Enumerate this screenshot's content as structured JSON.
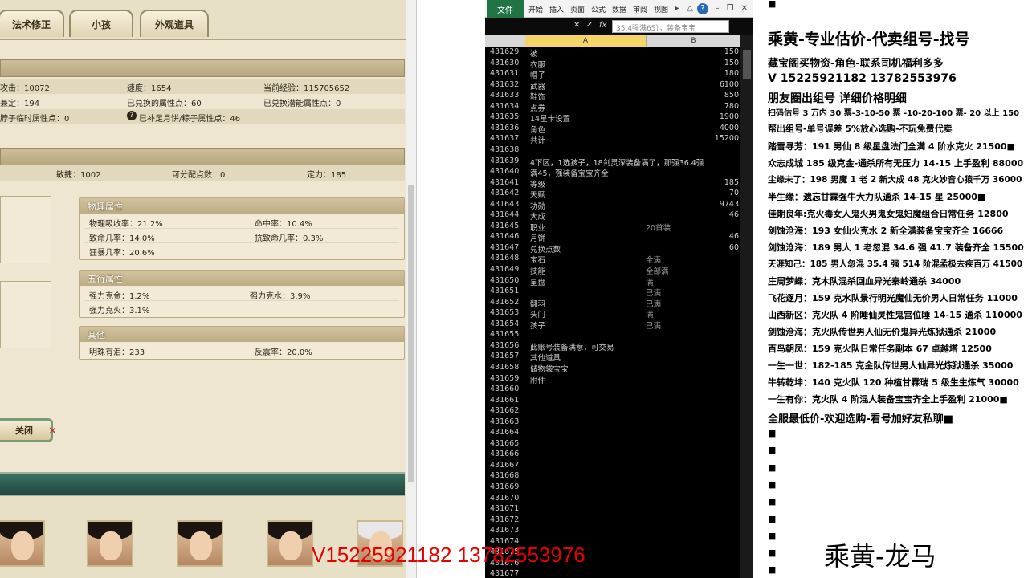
{
  "game": {
    "tabs": [
      "法术修正",
      "小孩",
      "外观道具"
    ],
    "stats_rows": [
      {
        "c1": "攻击：10072",
        "c2": "速度：1654",
        "c3": "当前经验：115705652"
      },
      {
        "c1": "兼定：194",
        "c2": "已兑换的属性点：60",
        "c3": "已兑换潜能属性点：0"
      },
      {
        "c1": "脖子临时属性点：0",
        "c2": "已补足月饼/粽子属性点：46",
        "c3": ""
      }
    ],
    "attr_row": {
      "c1": "敏捷：1002",
      "c2": "可分配点数：0",
      "c3": "定力：185"
    },
    "physical": {
      "title": "物理属性",
      "lines": [
        {
          "a": "物理吸收率：21.2%",
          "b": "命中率：10.4%"
        },
        {
          "a": "致命几率：14.0%",
          "b": "抗致命几率：0.3%"
        },
        {
          "a": "狂暴几率：20.6%",
          "b": ""
        }
      ]
    },
    "elements": {
      "title": "五行属性",
      "lines": [
        {
          "a": "强力克金：1.2%",
          "b": "强力克水：3.9%"
        },
        {
          "a": "强力克火：3.1%",
          "b": ""
        }
      ]
    },
    "other": {
      "title": "其他",
      "lines": [
        {
          "a": "明珠有泪：233",
          "b": "反震率：20.0%"
        }
      ]
    },
    "close_label": "关闭"
  },
  "excel": {
    "file_tab": "文件",
    "ribbon_tabs": [
      "开始",
      "插入",
      "页面",
      "公式",
      "数据",
      "审阅",
      "视图"
    ],
    "formula_text": "35.4强满65），装备宝宝",
    "col_a": "A",
    "col_b": "B",
    "rows": [
      {
        "n": "431629",
        "a": "被",
        "b": "150"
      },
      {
        "n": "431630",
        "a": "衣服",
        "b": "150"
      },
      {
        "n": "431631",
        "a": "帽子",
        "b": "180"
      },
      {
        "n": "431632",
        "a": "武器",
        "b": "6100"
      },
      {
        "n": "431633",
        "a": "鞋饰",
        "b": "850"
      },
      {
        "n": "431634",
        "a": "点券",
        "b": "780"
      },
      {
        "n": "431635",
        "a": "14星卡设置",
        "b": "1900"
      },
      {
        "n": "431636",
        "a": "角色",
        "b": "4000"
      },
      {
        "n": "431637",
        "a": "共计",
        "b": "15200"
      },
      {
        "n": "431638",
        "a": "",
        "b": ""
      },
      {
        "n": "431639",
        "a": "4下区，1选孩子，18剑灵深装备满了，那强36.4强",
        "b": ""
      },
      {
        "n": "431640",
        "a": "满45，强装备宝宝齐全",
        "b": ""
      },
      {
        "n": "431641",
        "a": "等级",
        "b": "185"
      },
      {
        "n": "431642",
        "a": "天赋",
        "b": "70"
      },
      {
        "n": "431643",
        "a": "功勋",
        "b": "9743"
      },
      {
        "n": "431644",
        "a": "大成",
        "b": "46"
      },
      {
        "n": "431645",
        "a": "职业",
        "m": "20首装"
      },
      {
        "n": "431646",
        "a": "月饼",
        "b": "46"
      },
      {
        "n": "431647",
        "a": "兑换点数",
        "b": "60"
      },
      {
        "n": "431648",
        "a": "宝石",
        "m": "全满"
      },
      {
        "n": "431649",
        "a": "技能",
        "m": "全部满"
      },
      {
        "n": "431650",
        "a": "星盘",
        "m": "满"
      },
      {
        "n": "431651",
        "a": "",
        "m": "已满"
      },
      {
        "n": "431652",
        "a": "翻羽",
        "m": "已满"
      },
      {
        "n": "431653",
        "a": "头门",
        "m": "满"
      },
      {
        "n": "431654",
        "a": "孩子",
        "m": "已满"
      },
      {
        "n": "431655",
        "a": "",
        "b": ""
      },
      {
        "n": "431656",
        "a": "此账号装备满意，可交易",
        "b": ""
      },
      {
        "n": "431657",
        "a": "其他道具",
        "b": ""
      },
      {
        "n": "431658",
        "a": "储物袋宝宝",
        "b": ""
      },
      {
        "n": "431659",
        "a": "附件",
        "b": ""
      },
      {
        "n": "431660",
        "a": "",
        "b": ""
      },
      {
        "n": "431661",
        "a": "",
        "b": ""
      },
      {
        "n": "431662",
        "a": "",
        "b": ""
      },
      {
        "n": "431663",
        "a": "",
        "b": ""
      },
      {
        "n": "431664",
        "a": "",
        "b": ""
      },
      {
        "n": "431665",
        "a": "",
        "b": ""
      },
      {
        "n": "431666",
        "a": "",
        "b": ""
      },
      {
        "n": "431667",
        "a": "",
        "b": ""
      },
      {
        "n": "431668",
        "a": "",
        "b": ""
      },
      {
        "n": "431669",
        "a": "",
        "b": ""
      },
      {
        "n": "431670",
        "a": "",
        "b": ""
      },
      {
        "n": "431671",
        "a": "",
        "b": ""
      },
      {
        "n": "431672",
        "a": "",
        "b": ""
      },
      {
        "n": "431673",
        "a": "",
        "b": ""
      },
      {
        "n": "431674",
        "a": "",
        "b": ""
      },
      {
        "n": "431675",
        "a": "",
        "b": ""
      },
      {
        "n": "431676",
        "a": "",
        "b": ""
      },
      {
        "n": "431677",
        "a": "",
        "b": ""
      }
    ]
  },
  "note": {
    "title": "乘黄-专业估价-代卖组号-找号",
    "lines": [
      {
        "t": "藏宝阁买物资-角色-联系司机福利多多",
        "cls": "mid"
      },
      {
        "t": "V 15225921182   13782553976",
        "cls": "big"
      },
      {
        "t": "朋友圈出组号   详细价格明细",
        "cls": "big"
      },
      {
        "t": "扫码估号 3 万内 30 票-3-10-50 票  -10-20-100 票- 20 以上 150",
        "cls": ""
      },
      {
        "t": "帮出组号-单号误差 5%放心选购-不玩免费代卖",
        "cls": ""
      },
      {
        "t": "踏雪寻芳：191 男仙 8 级星盘法门全满 4 阶水克火 21500■",
        "cls": ""
      },
      {
        "t": "众志成城  185 级克金-通杀所有无压力 14-15 上手盈利 88000",
        "cls": ""
      },
      {
        "t": "尘缘未了：198 男魔 1 老 2 新大成 48 克火妙音心猿千万 36000",
        "cls": ""
      },
      {
        "t": "半生缘：遗忘甘霖强牛大力队通杀 14-15 星 25000■",
        "cls": ""
      },
      {
        "t": "佳期良年:克火毒女人鬼火男鬼女鬼妇魔组合日常任务 12800",
        "cls": ""
      },
      {
        "t": "剑蚀沧海：193 女仙火克水 2 新全满装备宝宝齐全 16666",
        "cls": ""
      },
      {
        "t": "剑蚀沧海：189 男人 1 老忽混 34.6 强 41.7 装备齐全 15500",
        "cls": ""
      },
      {
        "t": "天涯知己：185 男人忽混 35.4 强 514 阶混孟极去疾百万 41500",
        "cls": ""
      },
      {
        "t": "庄周梦蝶：克木队混杀回血异光秦岭通杀 34000",
        "cls": ""
      },
      {
        "t": "飞花逐月：159 克水队景行明光魔仙无价男人日常任务 11000",
        "cls": ""
      },
      {
        "t": "山西新区：克火队 4 阶睡仙灵性鬼宫位睡 14-15 通杀 110000",
        "cls": ""
      },
      {
        "t": "剑蚀沧海：克火队传世男人仙无价鬼异光炼狱通杀 21000",
        "cls": ""
      },
      {
        "t": "百鸟朝凤：159 克火队日常任务副本 67 卓越塔 12500",
        "cls": ""
      },
      {
        "t": "一生一世：182-185 克金队传世男人仙异光炼狱通杀 35000",
        "cls": ""
      },
      {
        "t": "牛转乾坤：140 克火队 120 种植甘霖瑞 5 级生生炼气 30000",
        "cls": ""
      },
      {
        "t": "一生有你：克火队 4 阶混人装备宝宝齐全上手盈利 21000■",
        "cls": ""
      },
      {
        "t": "全服最低价-欢迎选购-看号加好友私聊■",
        "cls": "mid"
      }
    ],
    "bullet": "■",
    "signature": "乘黄-龙马"
  },
  "watermark": "V15225921182  13782553976"
}
